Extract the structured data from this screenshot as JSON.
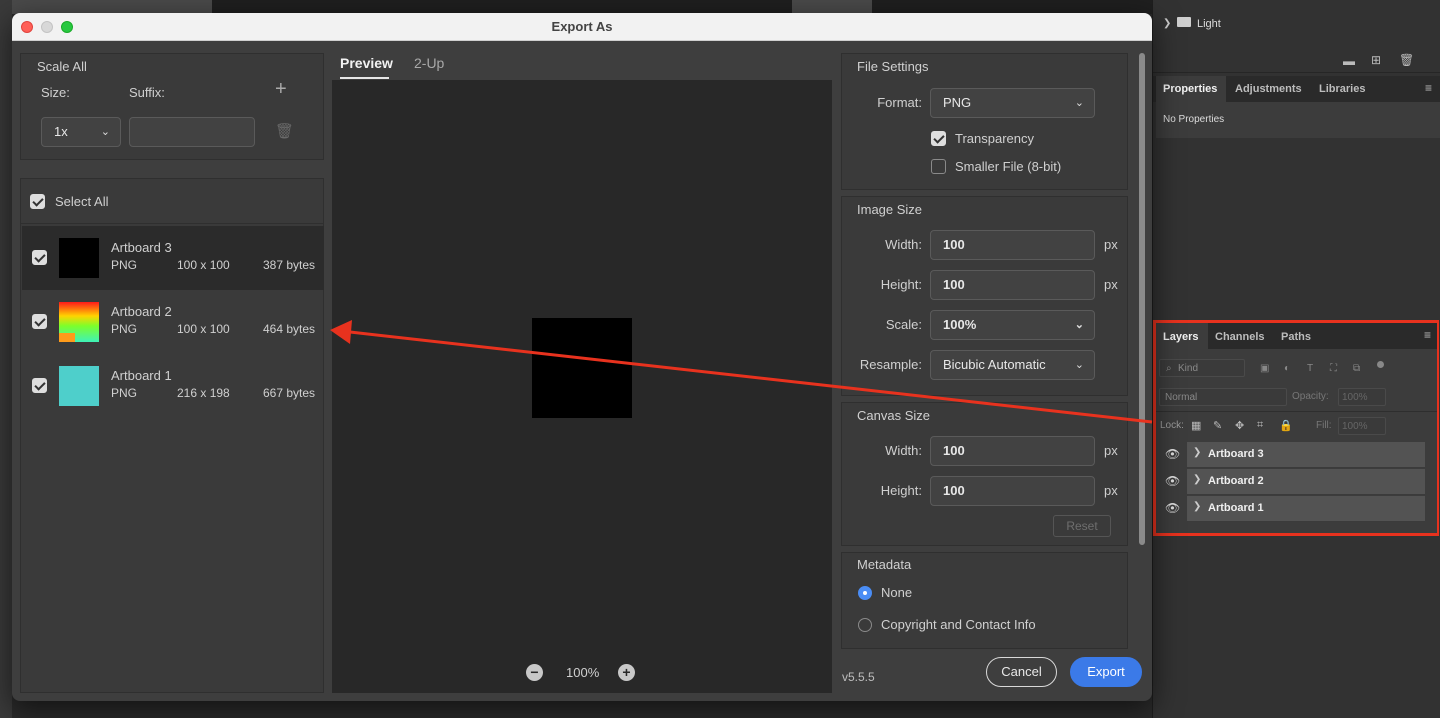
{
  "dialog": {
    "title": "Export As",
    "scale_all": {
      "heading": "Scale All",
      "size_label": "Size:",
      "suffix_label": "Suffix:",
      "size_value": "1x",
      "suffix_value": ""
    },
    "select_all": "Select All",
    "artboards": [
      {
        "name": "Artboard 3",
        "format": "PNG",
        "dims": "100 x 100",
        "size": "387 bytes",
        "checked": true,
        "thumb": "#000000"
      },
      {
        "name": "Artboard 2",
        "format": "PNG",
        "dims": "100 x 100",
        "size": "464 bytes",
        "checked": true,
        "thumb": "gradient"
      },
      {
        "name": "Artboard 1",
        "format": "PNG",
        "dims": "216 x 198",
        "size": "667 bytes",
        "checked": true,
        "thumb": "#4ecfcb"
      }
    ],
    "tabs": {
      "preview": "Preview",
      "two_up": "2-Up"
    },
    "zoom": "100%",
    "file_settings": {
      "heading": "File Settings",
      "format_label": "Format:",
      "format_value": "PNG",
      "transparency": "Transparency",
      "smaller_file": "Smaller File (8-bit)"
    },
    "image_size": {
      "heading": "Image Size",
      "width_label": "Width:",
      "width_value": "100",
      "height_label": "Height:",
      "height_value": "100",
      "scale_label": "Scale:",
      "scale_value": "100%",
      "resample_label": "Resample:",
      "resample_value": "Bicubic Automatic",
      "unit": "px"
    },
    "canvas_size": {
      "heading": "Canvas Size",
      "width_label": "Width:",
      "width_value": "100",
      "height_label": "Height:",
      "height_value": "100",
      "unit": "px",
      "reset": "Reset"
    },
    "metadata": {
      "heading": "Metadata",
      "none": "None",
      "copyright": "Copyright and Contact Info"
    },
    "version": "v5.5.5",
    "cancel": "Cancel",
    "export": "Export"
  },
  "ps": {
    "top_folder": "Light",
    "props_tabs": [
      "Properties",
      "Adjustments",
      "Libraries"
    ],
    "no_properties": "No Properties",
    "layers_tabs": [
      "Layers",
      "Channels",
      "Paths"
    ],
    "kind": "Kind",
    "blend": "Normal",
    "opacity_label": "Opacity:",
    "opacity_value": "100%",
    "lock_label": "Lock:",
    "fill_label": "Fill:",
    "fill_value": "100%",
    "layers": [
      "Artboard 3",
      "Artboard 2",
      "Artboard 1"
    ]
  },
  "colors": {
    "highlight": "#e8321e",
    "accent": "#3b7ae8"
  }
}
